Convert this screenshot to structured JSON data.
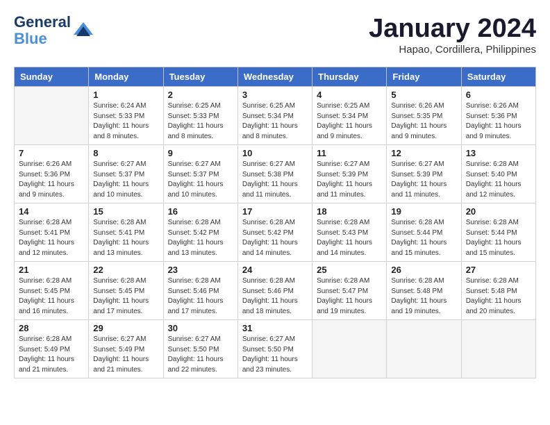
{
  "header": {
    "logo_line1": "General",
    "logo_line2": "Blue",
    "month_title": "January 2024",
    "subtitle": "Hapao, Cordillera, Philippines"
  },
  "days_of_week": [
    "Sunday",
    "Monday",
    "Tuesday",
    "Wednesday",
    "Thursday",
    "Friday",
    "Saturday"
  ],
  "weeks": [
    [
      {
        "num": "",
        "sunrise": "",
        "sunset": "",
        "daylight": ""
      },
      {
        "num": "1",
        "sunrise": "Sunrise: 6:24 AM",
        "sunset": "Sunset: 5:33 PM",
        "daylight": "Daylight: 11 hours and 8 minutes."
      },
      {
        "num": "2",
        "sunrise": "Sunrise: 6:25 AM",
        "sunset": "Sunset: 5:33 PM",
        "daylight": "Daylight: 11 hours and 8 minutes."
      },
      {
        "num": "3",
        "sunrise": "Sunrise: 6:25 AM",
        "sunset": "Sunset: 5:34 PM",
        "daylight": "Daylight: 11 hours and 8 minutes."
      },
      {
        "num": "4",
        "sunrise": "Sunrise: 6:25 AM",
        "sunset": "Sunset: 5:34 PM",
        "daylight": "Daylight: 11 hours and 9 minutes."
      },
      {
        "num": "5",
        "sunrise": "Sunrise: 6:26 AM",
        "sunset": "Sunset: 5:35 PM",
        "daylight": "Daylight: 11 hours and 9 minutes."
      },
      {
        "num": "6",
        "sunrise": "Sunrise: 6:26 AM",
        "sunset": "Sunset: 5:36 PM",
        "daylight": "Daylight: 11 hours and 9 minutes."
      }
    ],
    [
      {
        "num": "7",
        "sunrise": "Sunrise: 6:26 AM",
        "sunset": "Sunset: 5:36 PM",
        "daylight": "Daylight: 11 hours and 9 minutes."
      },
      {
        "num": "8",
        "sunrise": "Sunrise: 6:27 AM",
        "sunset": "Sunset: 5:37 PM",
        "daylight": "Daylight: 11 hours and 10 minutes."
      },
      {
        "num": "9",
        "sunrise": "Sunrise: 6:27 AM",
        "sunset": "Sunset: 5:37 PM",
        "daylight": "Daylight: 11 hours and 10 minutes."
      },
      {
        "num": "10",
        "sunrise": "Sunrise: 6:27 AM",
        "sunset": "Sunset: 5:38 PM",
        "daylight": "Daylight: 11 hours and 11 minutes."
      },
      {
        "num": "11",
        "sunrise": "Sunrise: 6:27 AM",
        "sunset": "Sunset: 5:39 PM",
        "daylight": "Daylight: 11 hours and 11 minutes."
      },
      {
        "num": "12",
        "sunrise": "Sunrise: 6:27 AM",
        "sunset": "Sunset: 5:39 PM",
        "daylight": "Daylight: 11 hours and 11 minutes."
      },
      {
        "num": "13",
        "sunrise": "Sunrise: 6:28 AM",
        "sunset": "Sunset: 5:40 PM",
        "daylight": "Daylight: 11 hours and 12 minutes."
      }
    ],
    [
      {
        "num": "14",
        "sunrise": "Sunrise: 6:28 AM",
        "sunset": "Sunset: 5:41 PM",
        "daylight": "Daylight: 11 hours and 12 minutes."
      },
      {
        "num": "15",
        "sunrise": "Sunrise: 6:28 AM",
        "sunset": "Sunset: 5:41 PM",
        "daylight": "Daylight: 11 hours and 13 minutes."
      },
      {
        "num": "16",
        "sunrise": "Sunrise: 6:28 AM",
        "sunset": "Sunset: 5:42 PM",
        "daylight": "Daylight: 11 hours and 13 minutes."
      },
      {
        "num": "17",
        "sunrise": "Sunrise: 6:28 AM",
        "sunset": "Sunset: 5:42 PM",
        "daylight": "Daylight: 11 hours and 14 minutes."
      },
      {
        "num": "18",
        "sunrise": "Sunrise: 6:28 AM",
        "sunset": "Sunset: 5:43 PM",
        "daylight": "Daylight: 11 hours and 14 minutes."
      },
      {
        "num": "19",
        "sunrise": "Sunrise: 6:28 AM",
        "sunset": "Sunset: 5:44 PM",
        "daylight": "Daylight: 11 hours and 15 minutes."
      },
      {
        "num": "20",
        "sunrise": "Sunrise: 6:28 AM",
        "sunset": "Sunset: 5:44 PM",
        "daylight": "Daylight: 11 hours and 15 minutes."
      }
    ],
    [
      {
        "num": "21",
        "sunrise": "Sunrise: 6:28 AM",
        "sunset": "Sunset: 5:45 PM",
        "daylight": "Daylight: 11 hours and 16 minutes."
      },
      {
        "num": "22",
        "sunrise": "Sunrise: 6:28 AM",
        "sunset": "Sunset: 5:45 PM",
        "daylight": "Daylight: 11 hours and 17 minutes."
      },
      {
        "num": "23",
        "sunrise": "Sunrise: 6:28 AM",
        "sunset": "Sunset: 5:46 PM",
        "daylight": "Daylight: 11 hours and 17 minutes."
      },
      {
        "num": "24",
        "sunrise": "Sunrise: 6:28 AM",
        "sunset": "Sunset: 5:46 PM",
        "daylight": "Daylight: 11 hours and 18 minutes."
      },
      {
        "num": "25",
        "sunrise": "Sunrise: 6:28 AM",
        "sunset": "Sunset: 5:47 PM",
        "daylight": "Daylight: 11 hours and 19 minutes."
      },
      {
        "num": "26",
        "sunrise": "Sunrise: 6:28 AM",
        "sunset": "Sunset: 5:48 PM",
        "daylight": "Daylight: 11 hours and 19 minutes."
      },
      {
        "num": "27",
        "sunrise": "Sunrise: 6:28 AM",
        "sunset": "Sunset: 5:48 PM",
        "daylight": "Daylight: 11 hours and 20 minutes."
      }
    ],
    [
      {
        "num": "28",
        "sunrise": "Sunrise: 6:28 AM",
        "sunset": "Sunset: 5:49 PM",
        "daylight": "Daylight: 11 hours and 21 minutes."
      },
      {
        "num": "29",
        "sunrise": "Sunrise: 6:27 AM",
        "sunset": "Sunset: 5:49 PM",
        "daylight": "Daylight: 11 hours and 21 minutes."
      },
      {
        "num": "30",
        "sunrise": "Sunrise: 6:27 AM",
        "sunset": "Sunset: 5:50 PM",
        "daylight": "Daylight: 11 hours and 22 minutes."
      },
      {
        "num": "31",
        "sunrise": "Sunrise: 6:27 AM",
        "sunset": "Sunset: 5:50 PM",
        "daylight": "Daylight: 11 hours and 23 minutes."
      },
      {
        "num": "",
        "sunrise": "",
        "sunset": "",
        "daylight": ""
      },
      {
        "num": "",
        "sunrise": "",
        "sunset": "",
        "daylight": ""
      },
      {
        "num": "",
        "sunrise": "",
        "sunset": "",
        "daylight": ""
      }
    ]
  ]
}
